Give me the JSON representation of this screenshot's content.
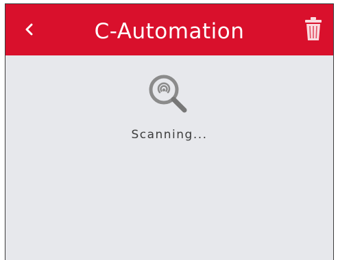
{
  "header": {
    "title": "C-Automation",
    "back_icon": "chevron-left-icon",
    "delete_icon": "trash-icon",
    "accent_color": "#d9102c"
  },
  "main": {
    "scan_icon": "search-signal-icon",
    "status_text": "Scanning..."
  }
}
